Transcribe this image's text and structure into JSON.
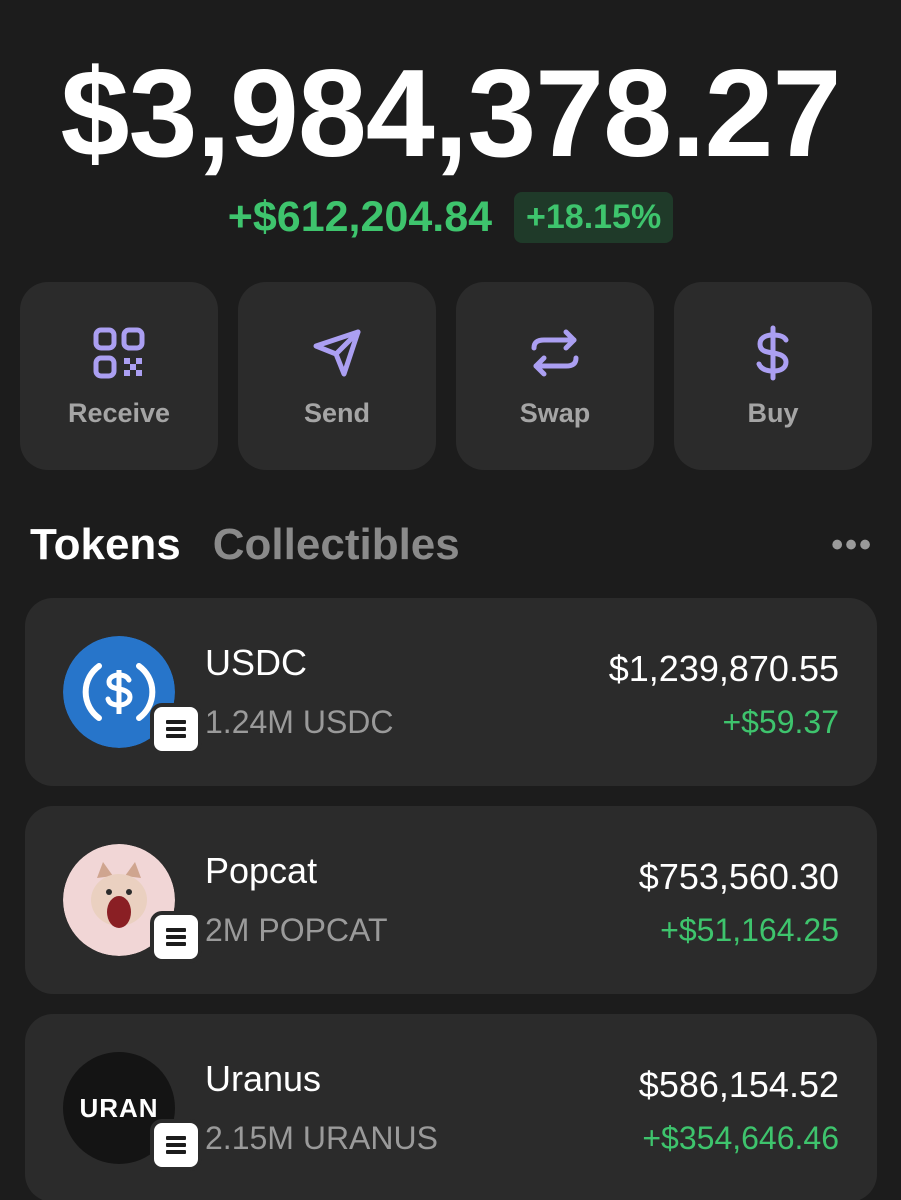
{
  "portfolio": {
    "balance": "$3,984,378.27",
    "change_amount": "+$612,204.84",
    "change_percent": "+18.15%"
  },
  "colors": {
    "background": "#1c1c1c",
    "card": "#2b2b2b",
    "accent": "#ab9ff2",
    "positive": "#3ec46d",
    "muted": "#9a9a9a"
  },
  "actions": [
    {
      "label": "Receive",
      "icon": "qr-code-icon"
    },
    {
      "label": "Send",
      "icon": "send-icon"
    },
    {
      "label": "Swap",
      "icon": "swap-icon"
    },
    {
      "label": "Buy",
      "icon": "dollar-icon"
    }
  ],
  "tabs": [
    {
      "label": "Tokens",
      "active": true
    },
    {
      "label": "Collectibles",
      "active": false
    }
  ],
  "more_label": "•••",
  "tokens": [
    {
      "name": "USDC",
      "amount": "1.24M USDC",
      "value": "$1,239,870.55",
      "change": "+$59.37",
      "icon": "usdc-logo-icon"
    },
    {
      "name": "Popcat",
      "amount": "2M POPCAT",
      "value": "$753,560.30",
      "change": "+$51,164.25",
      "icon": "popcat-logo-icon"
    },
    {
      "name": "Uranus",
      "amount": "2.15M URANUS",
      "value": "$586,154.52",
      "change": "+$354,646.46",
      "icon": "uranus-logo-icon",
      "logo_text": "URAN"
    }
  ]
}
